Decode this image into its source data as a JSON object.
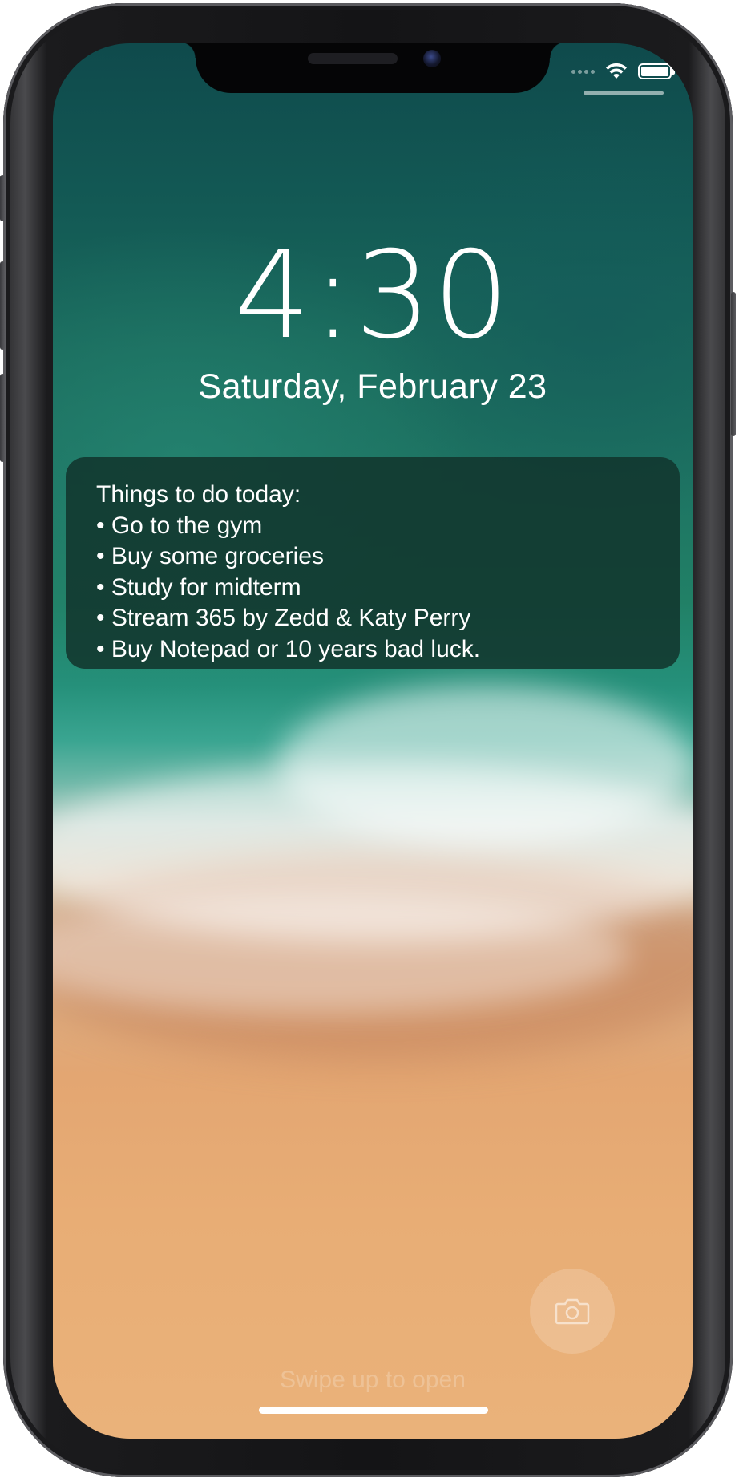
{
  "status_bar": {
    "wifi_icon": "wifi-icon",
    "battery_icon": "battery-icon",
    "battery_level": 1.0
  },
  "lock_screen": {
    "time": "4:30",
    "date": "Saturday, February 23"
  },
  "notification": {
    "lines": [
      "Things to do today:",
      "• Go to the gym",
      "• Buy some groceries",
      "• Study for midterm",
      "• Stream 365 by Zedd & Katy Perry",
      "• Buy Notepad or 10 years bad luck."
    ]
  },
  "bottom": {
    "camera_icon": "camera-icon",
    "swipe_hint": "Swipe up to open"
  },
  "colors": {
    "card_background": "#11342c",
    "text": "#ffffff"
  }
}
